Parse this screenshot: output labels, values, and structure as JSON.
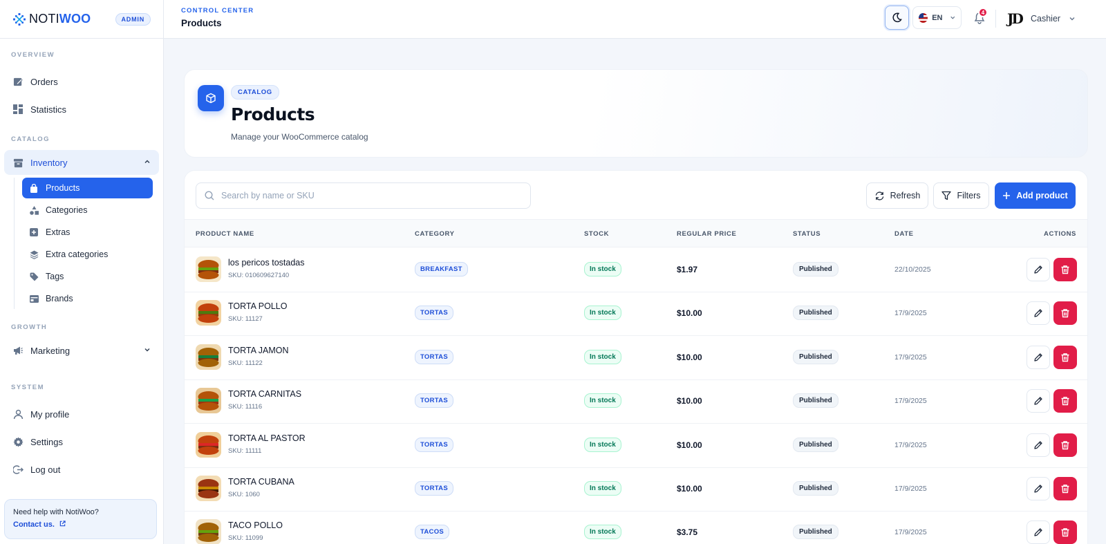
{
  "brand": {
    "name_prefix": "NOTI",
    "name_suffix": "WOO",
    "role_badge": "ADMIN"
  },
  "sidebar": {
    "sections": {
      "overview": "OVERVIEW",
      "catalog": "CATALOG",
      "growth": "GROWTH",
      "system": "SYSTEM"
    },
    "items": {
      "orders": "Orders",
      "statistics": "Statistics",
      "inventory": "Inventory",
      "marketing": "Marketing",
      "my_profile": "My profile",
      "settings": "Settings",
      "log_out": "Log out"
    },
    "inventory_sub": [
      "Products",
      "Categories",
      "Extras",
      "Extra categories",
      "Tags",
      "Brands"
    ],
    "help": {
      "title": "Need help with NotiWoo?",
      "link": "Contact us."
    }
  },
  "topbar": {
    "breadcrumb_top": "CONTROL CENTER",
    "breadcrumb_title": "Products",
    "language": "EN",
    "notification_count": "4",
    "user_initials": "JD",
    "user_name": "Cashier"
  },
  "header": {
    "tag": "CATALOG",
    "title": "Products",
    "subtitle": "Manage your WooCommerce catalog"
  },
  "toolbar": {
    "search_placeholder": "Search by name or SKU",
    "refresh_label": "Refresh",
    "filters_label": "Filters",
    "add_label": "Add product"
  },
  "table": {
    "columns": [
      "PRODUCT NAME",
      "CATEGORY",
      "STOCK",
      "REGULAR PRICE",
      "STATUS",
      "DATE",
      "ACTIONS"
    ],
    "rows": [
      {
        "name": "los pericos tostadas",
        "sku": "SKU: 010609627140",
        "category": "BREAKFAST",
        "stock": "In stock",
        "price": "$1.97",
        "status": "Published",
        "date": "22/10/2025"
      },
      {
        "name": "TORTA POLLO",
        "sku": "SKU: 11127",
        "category": "TORTAS",
        "stock": "In stock",
        "price": "$10.00",
        "status": "Published",
        "date": "17/9/2025"
      },
      {
        "name": "TORTA JAMON",
        "sku": "SKU: 11122",
        "category": "TORTAS",
        "stock": "In stock",
        "price": "$10.00",
        "status": "Published",
        "date": "17/9/2025"
      },
      {
        "name": "TORTA CARNITAS",
        "sku": "SKU: 11116",
        "category": "TORTAS",
        "stock": "In stock",
        "price": "$10.00",
        "status": "Published",
        "date": "17/9/2025"
      },
      {
        "name": "TORTA AL PASTOR",
        "sku": "SKU: 11111",
        "category": "TORTAS",
        "stock": "In stock",
        "price": "$10.00",
        "status": "Published",
        "date": "17/9/2025"
      },
      {
        "name": "TORTA CUBANA",
        "sku": "SKU: 1060",
        "category": "TORTAS",
        "stock": "In stock",
        "price": "$10.00",
        "status": "Published",
        "date": "17/9/2025"
      },
      {
        "name": "TACO POLLO",
        "sku": "SKU: 11099",
        "category": "TACOS",
        "stock": "In stock",
        "price": "$3.75",
        "status": "Published",
        "date": "17/9/2025"
      }
    ]
  },
  "colors": {
    "accent": "#2563eb",
    "danger": "#e11d48",
    "success": "#047857"
  }
}
